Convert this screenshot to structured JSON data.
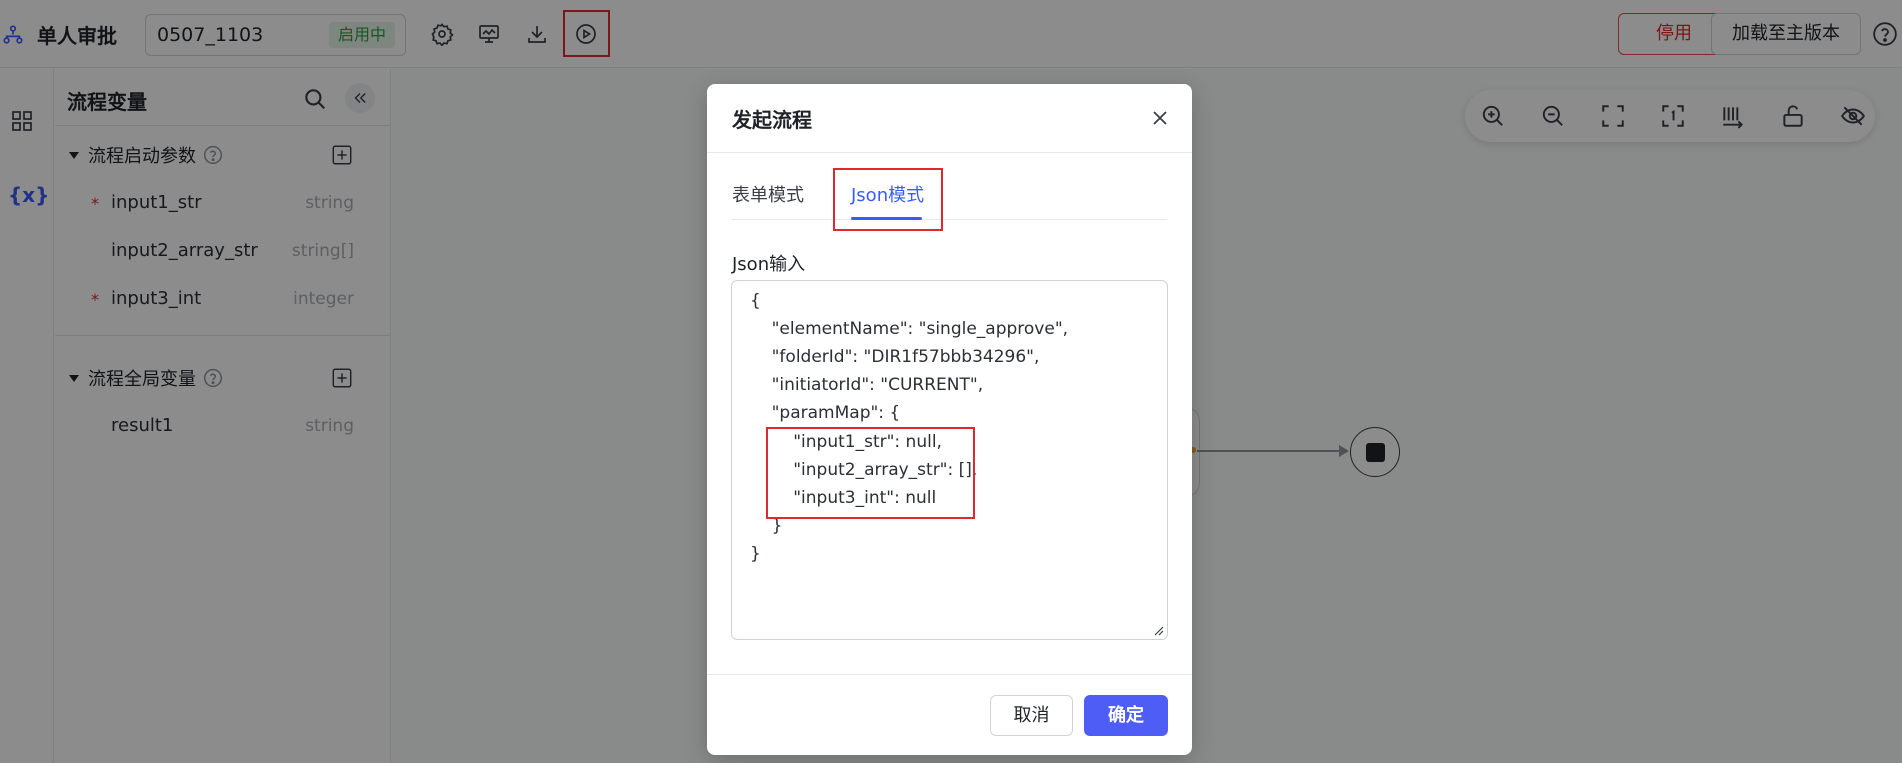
{
  "app": {
    "title": "单人审批",
    "logo_icon": "flow-diagram-icon"
  },
  "header": {
    "version": "0507_1103",
    "status": "启用中",
    "tools": [
      {
        "icon": "gear-icon"
      },
      {
        "icon": "monitor-chart-icon"
      },
      {
        "icon": "download-icon"
      },
      {
        "icon": "play-circle-icon"
      }
    ],
    "disable_label": "停用",
    "load_main_label": "加载至主版本",
    "help_icon": "question-circle-icon"
  },
  "sidebar": {
    "items": [
      {
        "icon": "grid-icon"
      },
      {
        "label": "{x}"
      }
    ]
  },
  "variables": {
    "panel_title": "流程变量",
    "start_params": {
      "title": "流程启动参数",
      "items": [
        {
          "name": "input1_str",
          "type": "string",
          "required": true
        },
        {
          "name": "input2_array_str",
          "type": "string[]",
          "required": false
        },
        {
          "name": "input3_int",
          "type": "integer",
          "required": true
        }
      ]
    },
    "global_vars": {
      "title": "流程全局变量",
      "items": [
        {
          "name": "result1",
          "type": "string",
          "required": false
        }
      ]
    }
  },
  "modal": {
    "title": "发起流程",
    "tabs": [
      {
        "label": "表单模式",
        "active": false
      },
      {
        "label": "Json模式",
        "active": true
      }
    ],
    "json_label": "Json输入",
    "json_lines": [
      "{",
      "    \"elementName\": \"single_approve\",",
      "    \"folderId\": \"DIR1f57bbb34296\",",
      "    \"initiatorId\": \"CURRENT\",",
      "    \"paramMap\": {",
      "        \"input1_str\": null,",
      "        \"input2_array_str\": [],",
      "        \"input3_int\": null",
      "    }",
      "}"
    ],
    "cancel_label": "取消",
    "confirm_label": "确定"
  },
  "colors": {
    "accent": "#4f5df7",
    "highlight_red": "#e0292e",
    "status_green": "#2e9d48"
  }
}
